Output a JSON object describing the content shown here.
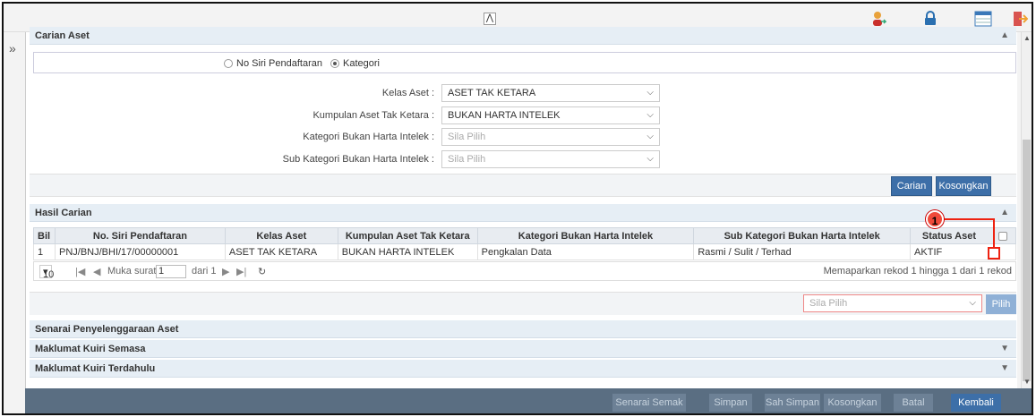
{
  "top": {
    "collapse_glyph": "⋀"
  },
  "carian": {
    "title": "Carian Aset",
    "radio1": "No Siri Pendaftaran",
    "radio2": "Kategori",
    "kelas_label": "Kelas Aset :",
    "kelas_value": "ASET TAK KETARA",
    "kumpulan_label": "Kumpulan Aset Tak Ketara :",
    "kumpulan_value": "BUKAN HARTA INTELEK",
    "kategori_label": "Kategori Bukan Harta Intelek :",
    "kategori_placeholder": "Sila Pilih",
    "sub_label": "Sub Kategori Bukan Harta Intelek :",
    "sub_placeholder": "Sila Pilih",
    "btn_carian": "Carian",
    "btn_kosongkan": "Kosongkan"
  },
  "hasil": {
    "title": "Hasil Carian",
    "columns": [
      "Bil",
      "No. Siri Pendaftaran",
      "Kelas Aset",
      "Kumpulan Aset Tak Ketara",
      "Kategori Bukan Harta Intelek",
      "Sub Kategori Bukan Harta Intelek",
      "Status Aset"
    ],
    "rows": [
      [
        "1",
        "PNJ/BNJ/BHI/17/00000001",
        "ASET TAK KETARA",
        "BUKAN HARTA INTELEK",
        "Pengkalan Data",
        "Rasmi / Sulit / Terhad",
        "AKTIF"
      ]
    ],
    "page_size": "10",
    "muka_surat_label": "Muka surat",
    "page": "1",
    "dari": "dari 1",
    "summary": "Memaparkan rekod 1 hingga 1 dari 1 rekod",
    "action_placeholder": "Sila Pilih",
    "btn_pilih": "Pilih"
  },
  "sections": {
    "senarai": "Senarai Penyelenggaraan Aset",
    "kuiri_semasa": "Maklumat Kuiri Semasa",
    "kuiri_terdahulu": "Maklumat Kuiri Terdahulu"
  },
  "bottom": {
    "senarai_semak": "Senarai Semak",
    "simpan": "Simpan",
    "sah_simpan": "Sah Simpan",
    "kosongkan": "Kosongkan",
    "batal": "Batal",
    "kembali": "Kembali"
  },
  "annotation": {
    "number": "1"
  }
}
